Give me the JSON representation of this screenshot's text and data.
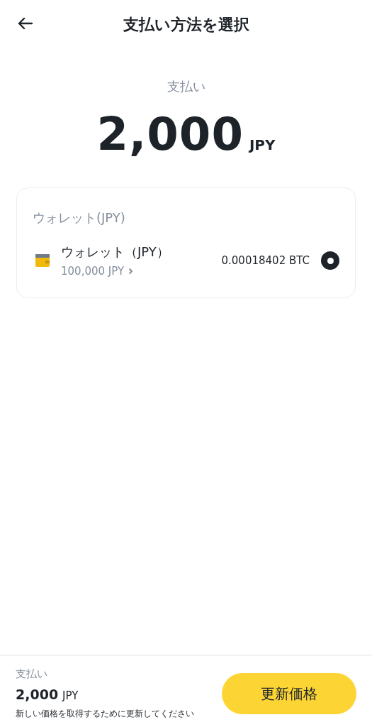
{
  "header": {
    "title": "支払い方法を選択"
  },
  "summary": {
    "label": "支払い",
    "amount": "2,000",
    "currency": "JPY"
  },
  "section": {
    "title": "ウォレット(JPY)",
    "options": [
      {
        "name": "ウォレット（JPY）",
        "balance": "100,000 JPY",
        "converted": "0.00018402 BTC",
        "selected": true
      }
    ]
  },
  "footer": {
    "label": "支払い",
    "amount": "2,000",
    "currency": "JPY",
    "note": "新しい価格を取得するために更新してください",
    "button": "更新価格"
  }
}
